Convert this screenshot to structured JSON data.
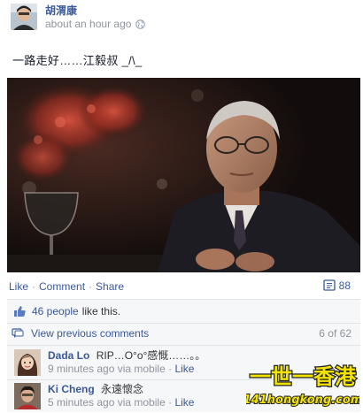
{
  "post": {
    "author": "胡渭康",
    "time": "about an hour ago",
    "privacy_icon": "globe-icon",
    "text": "一路走好……江毅叔 _/\\_"
  },
  "actions": {
    "like": "Like",
    "comment": "Comment",
    "share": "Share",
    "comment_count": "88"
  },
  "likes": {
    "count_text": "46 people",
    "suffix": "like this."
  },
  "comments_header": {
    "view_previous": "View previous comments",
    "paging": "6 of 62"
  },
  "comments": [
    {
      "name": "Dada Lo",
      "text": "RIP…O°o°感慨……。。",
      "time": "9 minutes ago via mobile",
      "like": "Like"
    },
    {
      "name": "Ki Cheng",
      "text": "永遠懷念",
      "time": "5 minutes ago via mobile",
      "like": "Like"
    }
  ],
  "watermark": {
    "title": "一世一香港",
    "site": "141hongkong.com"
  },
  "colors": {
    "link": "#3b5998",
    "muted": "#90949c",
    "ufi_bg": "#f6f7f9",
    "watermark_text": "#f3e300"
  }
}
